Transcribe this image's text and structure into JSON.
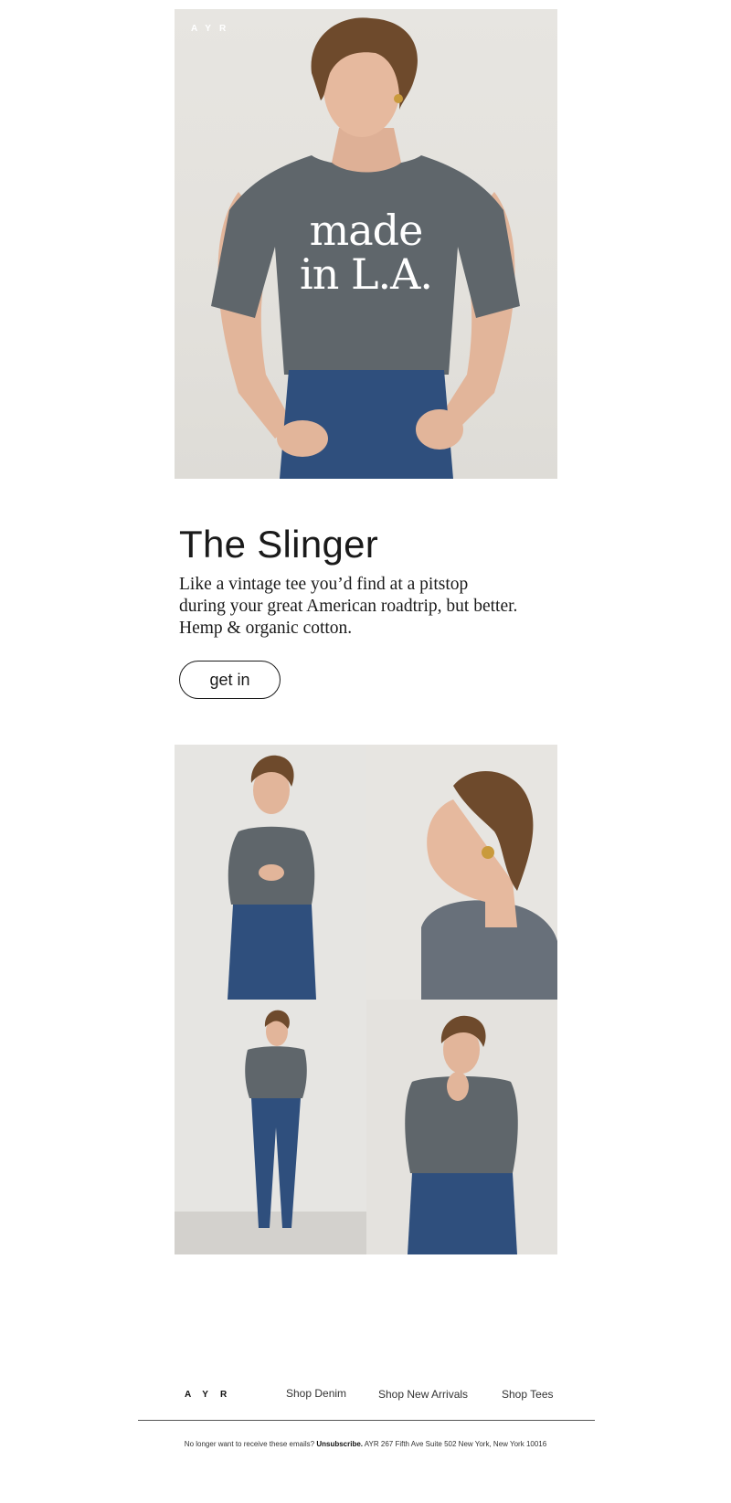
{
  "hero": {
    "logo": "AYR",
    "shirt_text_line1": "made",
    "shirt_text_line2": "in L.A.",
    "colors": {
      "backdrop": "#e4e2dd",
      "shirt": "#5f666b",
      "denim": "#2f4f7d",
      "skin": "#e2b59a",
      "hair": "#6e4a2c"
    }
  },
  "product": {
    "title": "The Slinger",
    "description_lines": [
      "Like a vintage tee you’d find at a pitstop",
      "during your great American roadtrip, but better.",
      "Hemp & organic cotton."
    ],
    "cta_label": "get in"
  },
  "gallery": {
    "tiles": [
      {
        "scene": "model holding hands at waist, three-quarter length"
      },
      {
        "scene": "profile of model smiling, close-up"
      },
      {
        "scene": "model full length standing"
      },
      {
        "scene": "model hand to chin, three-quarter length"
      }
    ]
  },
  "footer": {
    "logo": "AYR",
    "links": [
      "Shop Denim",
      "Shop New Arrivals",
      "Shop Tees"
    ],
    "legal_prefix": "No longer want to receive these emails?",
    "unsubscribe_label": "Unsubscribe.",
    "address": "AYR 267 Fifth Ave Suite 502 New York, New York 10016"
  }
}
